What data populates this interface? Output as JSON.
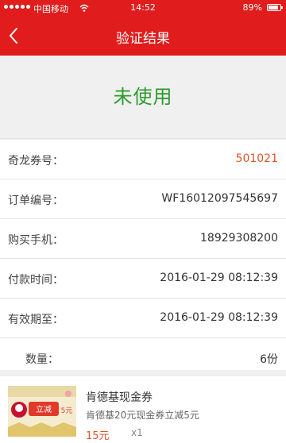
{
  "status_bar": {
    "carrier": "中国移动",
    "time": "14:52",
    "battery": "89%",
    "battery_level": 0.89
  },
  "nav": {
    "title": "验证结果",
    "back_icon": "chevron-left-icon"
  },
  "verification": {
    "status": "未使用",
    "status_color": "#2c9a2c"
  },
  "details": {
    "voucher_no": {
      "label": "奇龙券号：",
      "value": "501021"
    },
    "order_no": {
      "label": "订单编号：",
      "value": "WF16012097545697"
    },
    "phone": {
      "label": "购买手机：",
      "value": "18929308200"
    },
    "pay_time": {
      "label": "付款时间：",
      "value": "2016-01-29 08:12:39"
    },
    "valid_until": {
      "label": "有效期至：",
      "value": "2016-01-29 08:12:39"
    },
    "quantity": {
      "label": "数量：",
      "value": "6份"
    }
  },
  "product": {
    "name": "肯德基现金券",
    "description": "肯德基20元现金券立减5元",
    "price": "15元",
    "qty": "x1",
    "thumb_text": "立减",
    "thumb_amount": "5元"
  },
  "colors": {
    "brand_red": "#e01c1c",
    "accent_orange": "#e0542c"
  }
}
